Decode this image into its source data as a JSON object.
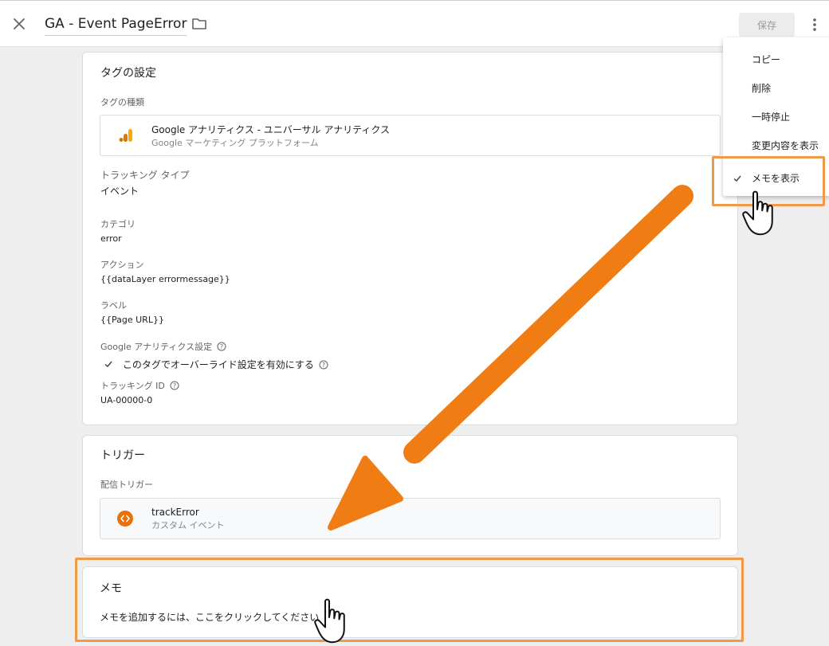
{
  "header": {
    "title": "GA - Event PageError",
    "save_label": "保存"
  },
  "menu": {
    "items": [
      {
        "label": "コピー"
      },
      {
        "label": "削除"
      },
      {
        "label": "一時停止"
      },
      {
        "label": "変更内容を表示"
      },
      {
        "label": "メモを表示",
        "checked": true
      }
    ]
  },
  "tag_config": {
    "section_title": "タグの設定",
    "tag_type_label": "タグの種類",
    "tag_type_name": "Google アナリティクス - ユニバーサル アナリティクス",
    "tag_type_vendor": "Google マーケティング プラットフォーム",
    "fields": [
      {
        "label": "トラッキング タイプ",
        "value": "イベント"
      },
      {
        "label": "カテゴリ",
        "value": "error"
      },
      {
        "label": "アクション",
        "value": "{{dataLayer errormessage}}"
      },
      {
        "label": "ラベル",
        "value": "{{Page URL}}"
      }
    ],
    "ga_settings_label": "Google アナリティクス設定",
    "override_label": "このタグでオーバーライド設定を有効にする",
    "tracking_id_label": "トラッキング ID",
    "tracking_id_value": "UA-00000-0"
  },
  "triggers": {
    "section_title": "トリガー",
    "firing_label": "配信トリガー",
    "trigger_name": "trackError",
    "trigger_type": "カスタム イベント"
  },
  "notes": {
    "section_title": "メモ",
    "placeholder": "メモを追加するには、ここをクリックしてください"
  },
  "colors": {
    "highlight": "#f0994a",
    "arrow": "#f07d14",
    "ga_orange": "#f9ab00",
    "ga_dark": "#e37400",
    "trigger_icon": "#e8710a"
  }
}
